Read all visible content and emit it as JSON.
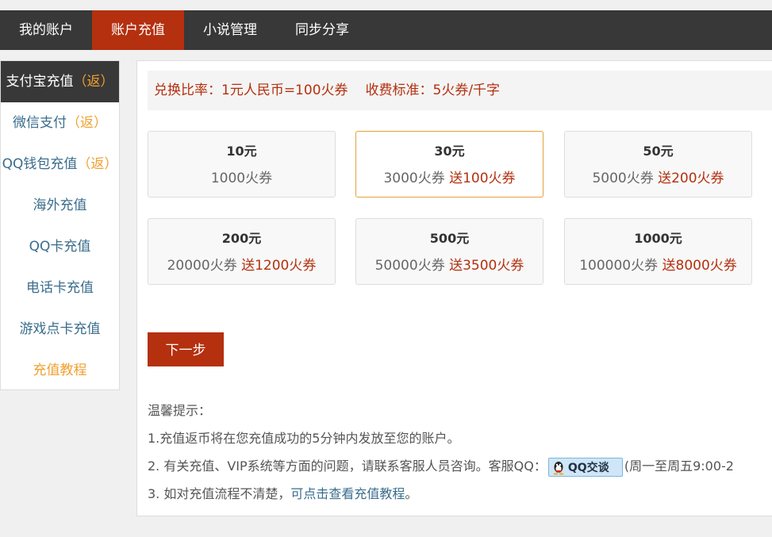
{
  "topnav": {
    "items": [
      {
        "label": "我的账户",
        "active": false
      },
      {
        "label": "账户充值",
        "active": true
      },
      {
        "label": "小说管理",
        "active": false
      },
      {
        "label": "同步分享",
        "active": false
      }
    ]
  },
  "sidebar": {
    "items": [
      {
        "label": "支付宝充值",
        "tag": "（返）",
        "active": true
      },
      {
        "label": "微信支付",
        "tag": "（返）"
      },
      {
        "label": "QQ钱包充值",
        "tag": "（返）"
      },
      {
        "label": "海外充值",
        "tag": ""
      },
      {
        "label": "QQ卡充值",
        "tag": ""
      },
      {
        "label": "电话卡充值",
        "tag": ""
      },
      {
        "label": "游戏点卡充值",
        "tag": ""
      },
      {
        "label": "充值教程",
        "tag": ""
      }
    ]
  },
  "rate": {
    "exchange": "兑换比率：1元人民币=100火券",
    "fee": "收费标准：5火券/千字"
  },
  "packages": [
    {
      "amount": "10元",
      "coins": "1000火券",
      "bonus": "",
      "selected": false
    },
    {
      "amount": "30元",
      "coins": "3000火券",
      "bonus": "送100火券",
      "selected": true
    },
    {
      "amount": "50元",
      "coins": "5000火券",
      "bonus": "送200火券",
      "selected": false
    },
    {
      "amount": "200元",
      "coins": "20000火券",
      "bonus": "送1200火券",
      "selected": false
    },
    {
      "amount": "500元",
      "coins": "50000火券",
      "bonus": "送3500火券",
      "selected": false
    },
    {
      "amount": "1000元",
      "coins": "100000火券",
      "bonus": "送8000火券",
      "selected": false
    }
  ],
  "next_button": "下一步",
  "tips": {
    "title": "温馨提示：",
    "line1": "1.充值返币将在您充值成功的5分钟内发放至您的账户。",
    "line2_prefix": "2. 有关充值、VIP系统等方面的问题，请联系客服人员咨询。客服QQ：",
    "qq_button": "QQ交谈",
    "line2_suffix": "(周一至周五9:00-2",
    "line3_prefix": "3. 如对充值流程不清楚，",
    "line3_link": "可点击查看充值教程",
    "line3_suffix": "。"
  },
  "colors": {
    "accent": "#b4300f",
    "nav_bg": "#383838",
    "tag_orange": "#f0a030",
    "link_blue": "#3a6d8c",
    "selected_border": "#e3a33a"
  }
}
